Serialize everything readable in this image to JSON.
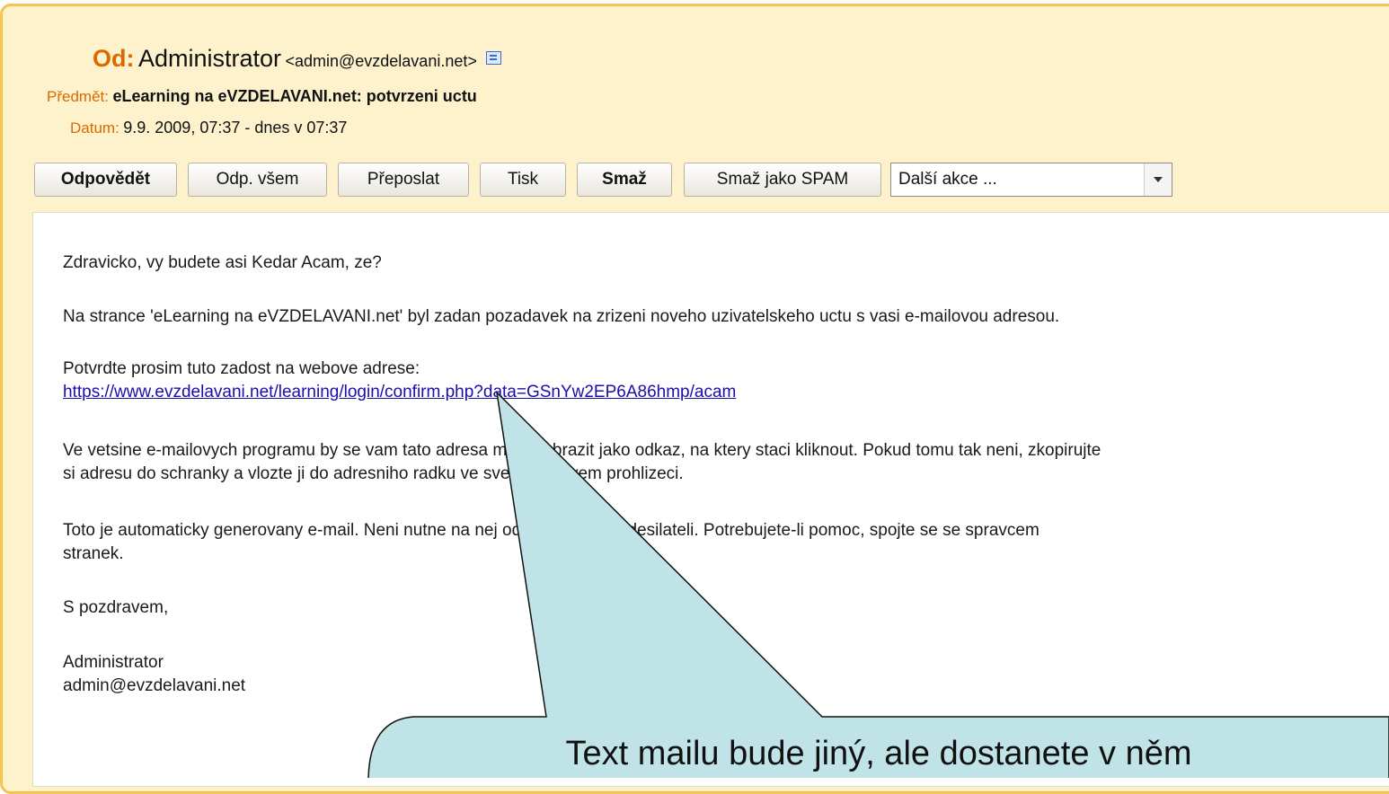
{
  "header": {
    "from_key": "Od:",
    "from_name": "Administrator",
    "from_email": "<admin@evzdelavani.net>",
    "subject_key": "Předmět:",
    "subject_value": "eLearning na eVZDELAVANI.net: potvrzeni uctu",
    "date_key": "Datum:",
    "date_value": "9.9. 2009, 07:37 - dnes v 07:37"
  },
  "toolbar": {
    "reply": "Odpovědět",
    "reply_all": "Odp. všem",
    "forward": "Přeposlat",
    "print": "Tisk",
    "delete": "Smaž",
    "delete_spam": "Smaž jako SPAM",
    "more_actions": "Další akce ..."
  },
  "message": {
    "greeting": "Zdravicko, vy budete asi Kedar Acam, ze?",
    "para1": "Na strance 'eLearning na eVZDELAVANI.net' byl zadan pozadavek na zrizeni noveho uzivatelskeho uctu s vasi e-mailovou adresou.",
    "para2": "Potvrdte prosim tuto zadost na webove adrese:",
    "link": "https://www.evzdelavani.net/learning/login/confirm.php?data=GSnYw2EP6A86hmp/acam",
    "para3_line1": "Ve vetsine e-mailovych programu by se vam tato adresa mela zobrazit jako odkaz, na ktery staci kliknout. Pokud tomu tak neni, zkopirujte",
    "para3_line2": "si adresu do schranky a vlozte ji do adresniho radku ve svem webovem prohlizeci.",
    "para4_line1": "Toto je automaticky generovany e-mail. Neni nutne na nej odpovidat jeho odesilateli. Potrebujete-li pomoc, spojte se se spravcem",
    "para4_line2": "stranek.",
    "closing": "S pozdravem,",
    "sig_name": "Administrator",
    "sig_email": "admin@evzdelavani.net"
  },
  "callout": {
    "text": "Text mailu bude jiný, ale dostanete v něm"
  },
  "colors": {
    "frame_border": "#f5c451",
    "frame_bg": "#fdf2cc",
    "label_orange": "#d96a00",
    "callout_fill": "#bfe3e6",
    "link": "#1a0dab"
  }
}
